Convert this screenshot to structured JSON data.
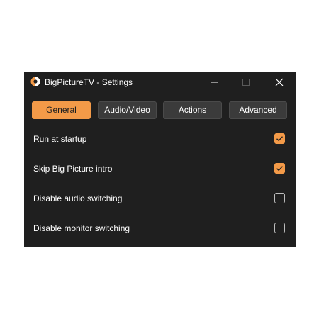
{
  "window": {
    "title": "BigPictureTV - Settings",
    "accent_color": "#f39a48",
    "background_color": "#1f1f1f"
  },
  "controls": {
    "minimize_icon": "minimize-icon",
    "maximize_icon": "maximize-icon",
    "close_icon": "close-icon"
  },
  "tabs": [
    {
      "label": "General",
      "active": true
    },
    {
      "label": "Audio/Video",
      "active": false
    },
    {
      "label": "Actions",
      "active": false
    },
    {
      "label": "Advanced",
      "active": false
    }
  ],
  "settings": [
    {
      "label": "Run at startup",
      "checked": true
    },
    {
      "label": "Skip Big Picture intro",
      "checked": true
    },
    {
      "label": "Disable audio switching",
      "checked": false
    },
    {
      "label": "Disable monitor switching",
      "checked": false
    }
  ]
}
